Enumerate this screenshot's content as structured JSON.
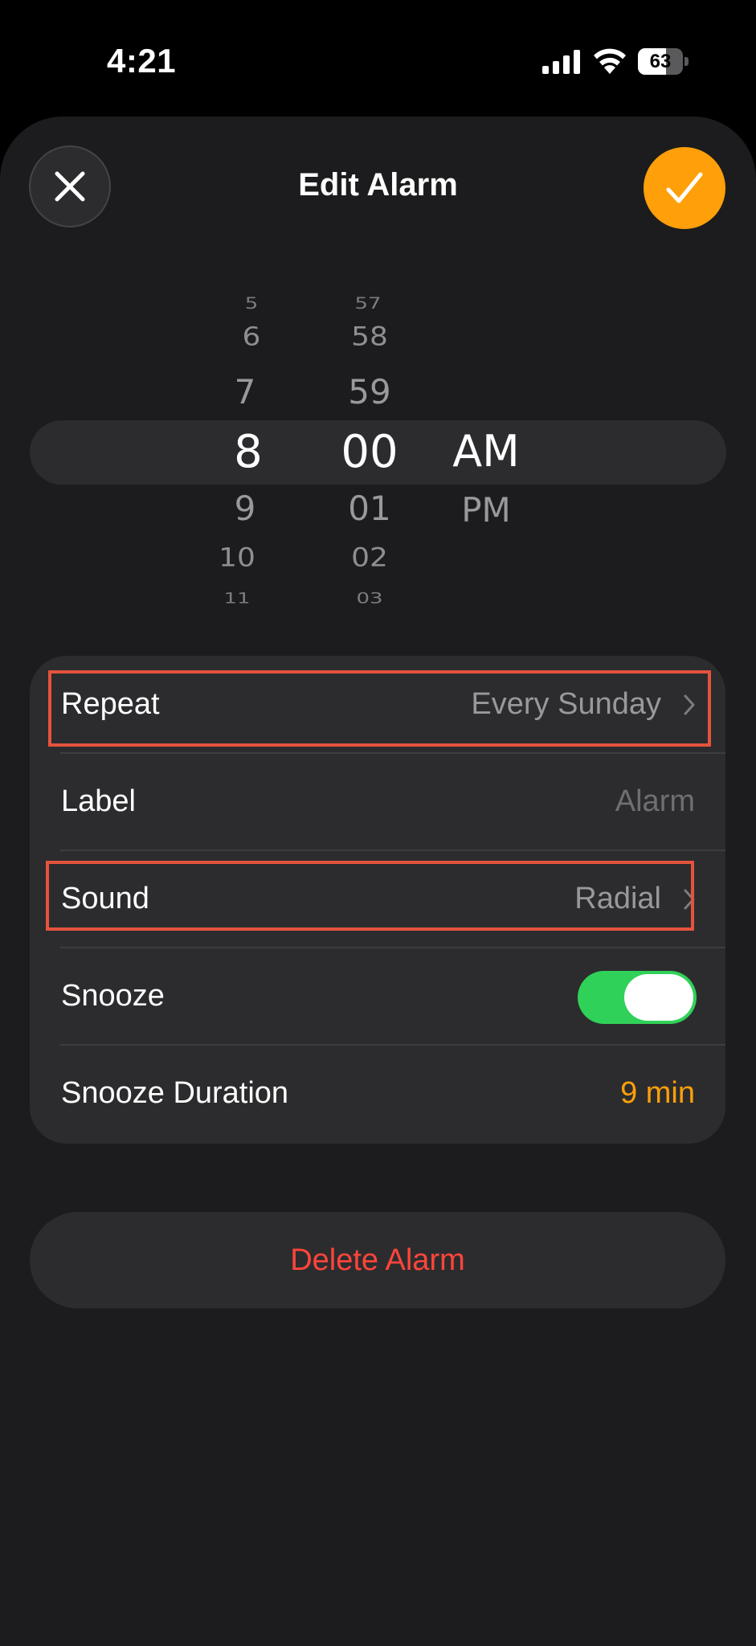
{
  "status_bar": {
    "time": "4:21",
    "battery": "63",
    "battery_level": 0.63
  },
  "header": {
    "title": "Edit Alarm",
    "close_icon": "xmark-icon",
    "confirm_icon": "checkmark-icon"
  },
  "picker": {
    "hours": {
      "above": [
        "5",
        "6",
        "7"
      ],
      "selected": "8",
      "below": [
        "9",
        "10",
        "11"
      ]
    },
    "minutes": {
      "above": [
        "57",
        "58",
        "59"
      ],
      "selected": "00",
      "below": [
        "01",
        "02",
        "03"
      ]
    },
    "period": {
      "selected": "AM",
      "below": "PM"
    }
  },
  "settings": {
    "repeat": {
      "label": "Repeat",
      "value": "Every Sunday"
    },
    "label": {
      "label": "Label",
      "placeholder": "Alarm"
    },
    "sound": {
      "label": "Sound",
      "value": "Radial"
    },
    "snooze": {
      "label": "Snooze",
      "enabled": true
    },
    "snooze_duration": {
      "label": "Snooze Duration",
      "value": "9 min"
    }
  },
  "delete_label": "Delete Alarm",
  "colors": {
    "accent": "#ff9f0a",
    "toggle_on": "#30d158",
    "destructive": "#ff453a",
    "annotation": "#e5533d"
  }
}
